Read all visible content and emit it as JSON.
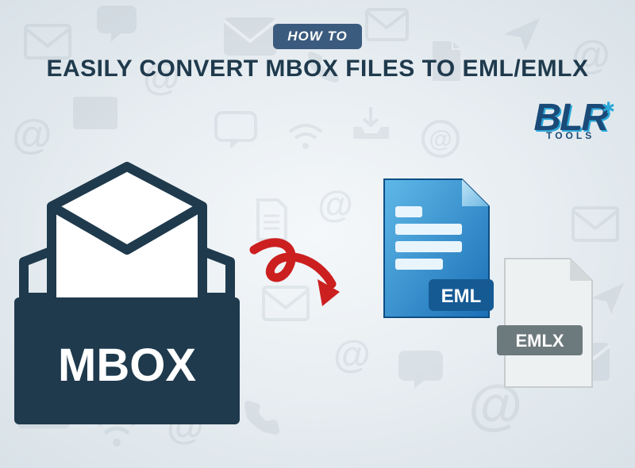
{
  "header": {
    "badge": "HOW TO",
    "headline": "EASILY CONVERT MBOX FILES TO EML/EMLX"
  },
  "logo": {
    "main": "BLR",
    "sub": "TOOLS"
  },
  "labels": {
    "mbox": "MBOX",
    "eml": "EML",
    "emlx": "EMLX"
  }
}
